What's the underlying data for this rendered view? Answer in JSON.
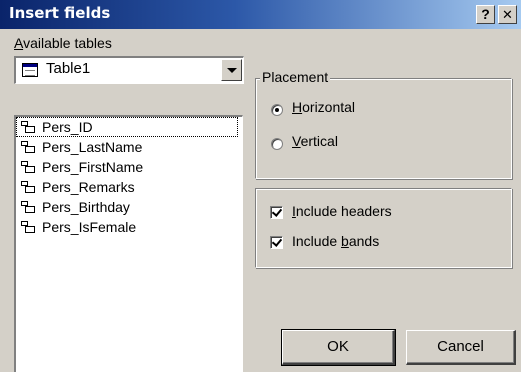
{
  "window": {
    "title": "Insert fields",
    "help_label": "?",
    "close_label": "✕"
  },
  "available_tables": {
    "label_accel": "A",
    "label_rest": "vailable tables",
    "selected_table": "Table1",
    "table_icon": "table-icon",
    "fields": [
      {
        "name": "Pers_ID",
        "icon": "field-icon"
      },
      {
        "name": "Pers_LastName",
        "icon": "field-icon"
      },
      {
        "name": "Pers_FirstName",
        "icon": "field-icon"
      },
      {
        "name": "Pers_Remarks",
        "icon": "field-icon"
      },
      {
        "name": "Pers_Birthday",
        "icon": "field-icon"
      },
      {
        "name": "Pers_IsFemale",
        "icon": "field-icon"
      }
    ]
  },
  "placement": {
    "label": "Placement",
    "horizontal": {
      "accel": "H",
      "rest": "orizontal",
      "selected": true
    },
    "vertical": {
      "accel": "V",
      "rest": "ertical",
      "selected": false
    }
  },
  "options": {
    "include_headers": {
      "pre": "",
      "accel": "I",
      "rest": "nclude headers",
      "checked": true
    },
    "include_bands": {
      "pre": "Include ",
      "accel": "b",
      "rest": "ands",
      "checked": true
    }
  },
  "buttons": {
    "ok": "OK",
    "cancel": "Cancel"
  }
}
